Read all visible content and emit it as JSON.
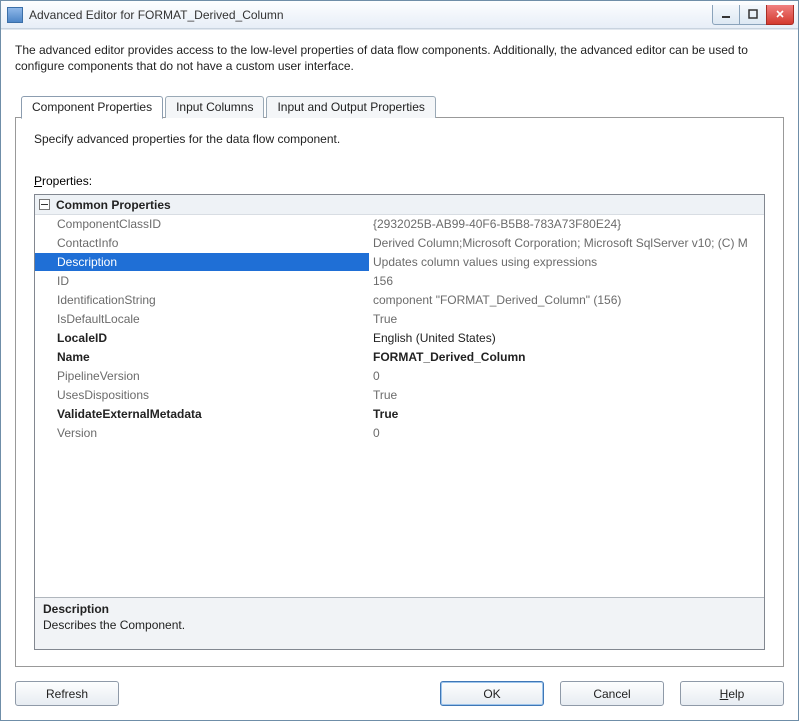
{
  "window": {
    "title": "Advanced Editor for FORMAT_Derived_Column"
  },
  "intro": "The advanced editor provides access to the low-level properties of data flow components. Additionally, the advanced editor can be used to configure components that do not have a custom user interface.",
  "tabs": [
    {
      "label": "Component Properties",
      "active": true
    },
    {
      "label": "Input Columns",
      "active": false
    },
    {
      "label": "Input and Output Properties",
      "active": false
    }
  ],
  "hint": "Specify advanced properties for the data flow component.",
  "properties_label": {
    "pre": "P",
    "rest": "roperties:"
  },
  "group_header": "Common Properties",
  "rows": [
    {
      "name": "ComponentClassID",
      "value": "{2932025B-AB99-40F6-B5B8-783A73F80E24}",
      "style": "norm"
    },
    {
      "name": "ContactInfo",
      "value": "Derived Column;Microsoft Corporation; Microsoft SqlServer v10; (C) M",
      "style": "norm"
    },
    {
      "name": "Description",
      "value": "Updates column values using expressions",
      "style": "sel"
    },
    {
      "name": "ID",
      "value": "156",
      "style": "norm"
    },
    {
      "name": "IdentificationString",
      "value": "component \"FORMAT_Derived_Column\" (156)",
      "style": "norm"
    },
    {
      "name": "IsDefaultLocale",
      "value": "True",
      "style": "norm"
    },
    {
      "name": "LocaleID",
      "value": "English (United States)",
      "style": "bold normval"
    },
    {
      "name": "Name",
      "value": "FORMAT_Derived_Column",
      "style": "bold"
    },
    {
      "name": "PipelineVersion",
      "value": "0",
      "style": "norm"
    },
    {
      "name": "UsesDispositions",
      "value": "True",
      "style": "norm"
    },
    {
      "name": "ValidateExternalMetadata",
      "value": "True",
      "style": "bold"
    },
    {
      "name": "Version",
      "value": "0",
      "style": "norm"
    }
  ],
  "desc": {
    "header": "Description",
    "text": "Describes the Component."
  },
  "buttons": {
    "refresh": "Refresh",
    "ok": "OK",
    "cancel": "Cancel",
    "help_pre": "H",
    "help_rest": "elp"
  }
}
